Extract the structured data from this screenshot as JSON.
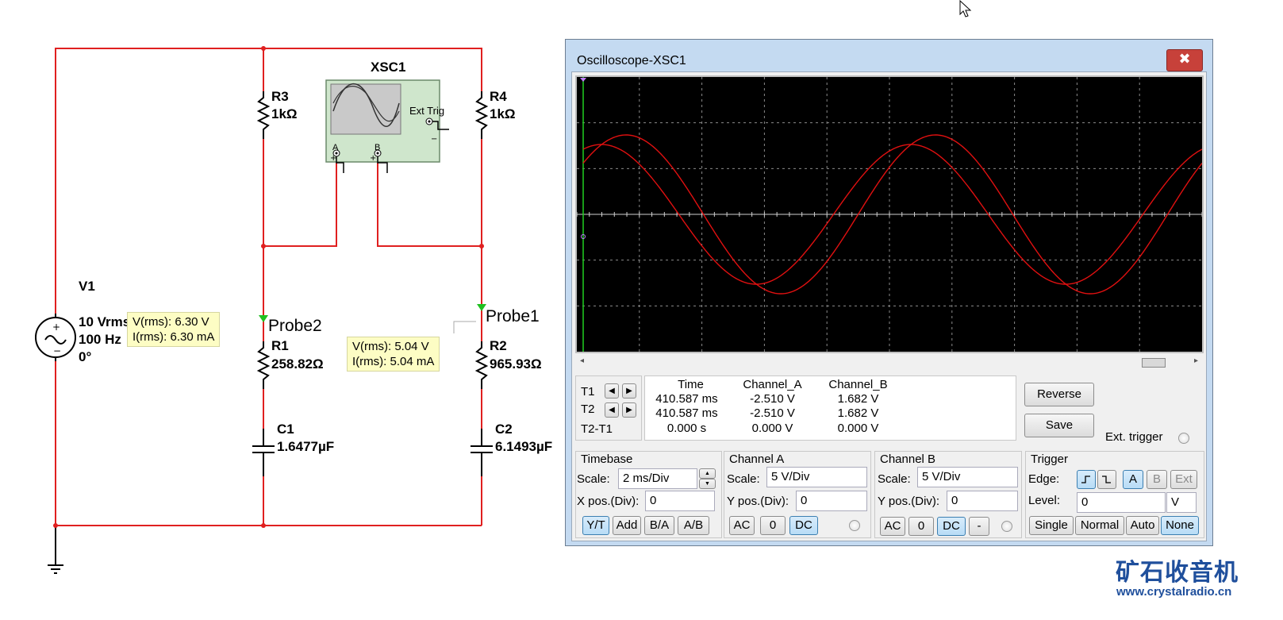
{
  "schematic": {
    "xsc_label": "XSC1",
    "xsc_ext_trig": "Ext Trig",
    "xsc_a": "A",
    "xsc_b": "B",
    "v1": {
      "name": "V1",
      "line1": "10 Vrms",
      "line2": "100 Hz",
      "line3": "0°"
    },
    "r3": {
      "name": "R3",
      "value": "1kΩ"
    },
    "r4": {
      "name": "R4",
      "value": "1kΩ"
    },
    "r1": {
      "name": "R1",
      "value": "258.82Ω"
    },
    "r2": {
      "name": "R2",
      "value": "965.93Ω"
    },
    "c1": {
      "name": "C1",
      "value": "1.6477µF"
    },
    "c2": {
      "name": "C2",
      "value": "6.1493µF"
    },
    "probe2": {
      "name": "Probe2",
      "vrms": "V(rms): 6.30 V",
      "irms": "I(rms): 6.30 mA"
    },
    "probe1": {
      "name": "Probe1",
      "vrms": "V(rms): 5.04 V",
      "irms": "I(rms): 5.04 mA"
    },
    "wire_color": "#e02020"
  },
  "oscilloscope": {
    "title": "Oscilloscope-XSC1",
    "close_glyph": "✖",
    "readout": {
      "headers": [
        "Time",
        "Channel_A",
        "Channel_B"
      ],
      "rows": [
        {
          "label": "T1",
          "time": "410.587 ms",
          "a": "-2.510 V",
          "b": "1.682 V"
        },
        {
          "label": "T2",
          "time": "410.587 ms",
          "a": "-2.510 V",
          "b": "1.682 V"
        },
        {
          "label": "T2-T1",
          "time": "0.000 s",
          "a": "0.000 V",
          "b": "0.000 V"
        }
      ]
    },
    "reverse_label": "Reverse",
    "save_label": "Save",
    "ext_trigger_label": "Ext. trigger",
    "timebase": {
      "title": "Timebase",
      "scale_label": "Scale:",
      "scale_value": "2 ms/Div",
      "xpos_label": "X pos.(Div):",
      "xpos_value": "0",
      "buttons": [
        "Y/T",
        "Add",
        "B/A",
        "A/B"
      ]
    },
    "channel_a": {
      "title": "Channel A",
      "scale_label": "Scale:",
      "scale_value": "5  V/Div",
      "ypos_label": "Y pos.(Div):",
      "ypos_value": "0",
      "buttons": [
        "AC",
        "0",
        "DC"
      ]
    },
    "channel_b": {
      "title": "Channel B",
      "scale_label": "Scale:",
      "scale_value": "5  V/Div",
      "ypos_label": "Y pos.(Div):",
      "ypos_value": "0",
      "buttons": [
        "AC",
        "0",
        "DC",
        "-"
      ]
    },
    "trigger": {
      "title": "Trigger",
      "edge_label": "Edge:",
      "edge_buttons": [
        "A",
        "B",
        "Ext"
      ],
      "level_label": "Level:",
      "level_value": "0",
      "level_unit": "V",
      "mode_buttons": [
        "Single",
        "Normal",
        "Auto",
        "None"
      ]
    },
    "trace_color": "#e01010"
  },
  "watermark": {
    "cn": "矿石收音机",
    "url": "www.crystalradio.cn"
  }
}
